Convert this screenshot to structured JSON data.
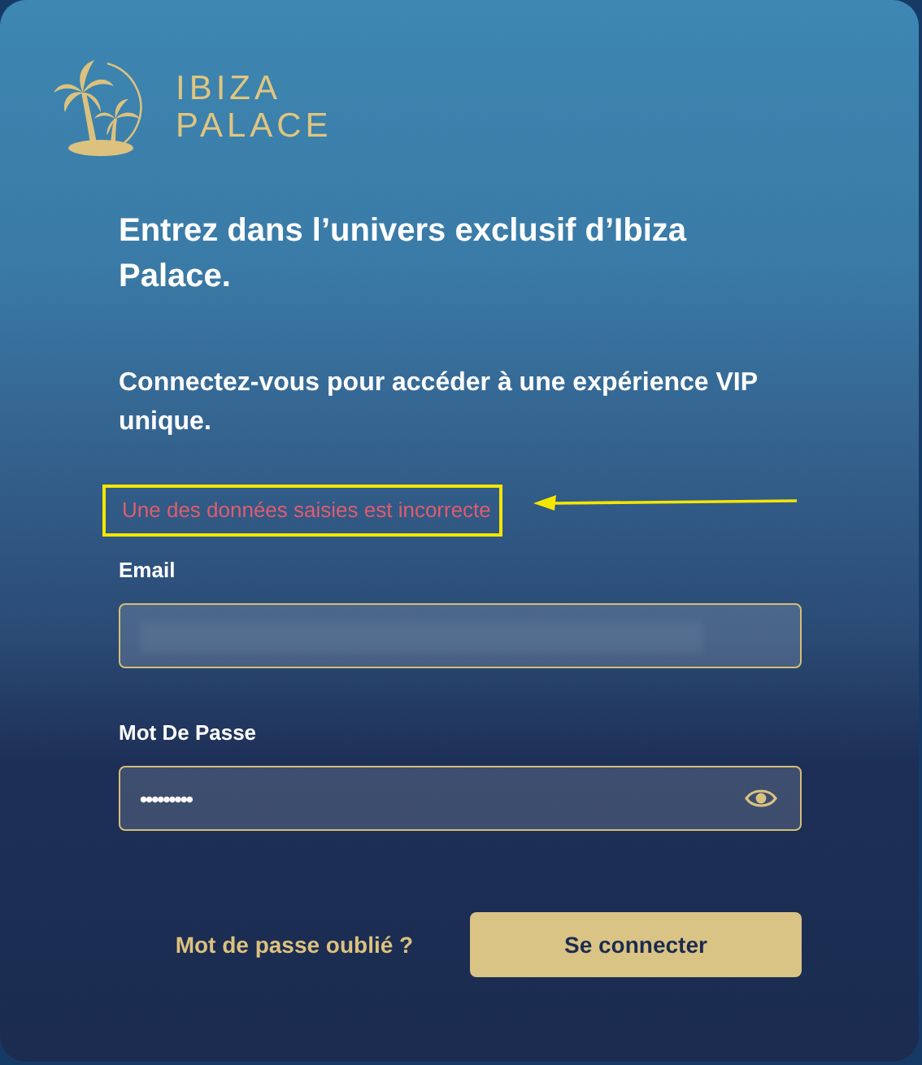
{
  "logo": {
    "lines": [
      "IBIZA",
      "PALACE"
    ]
  },
  "heading": "Entrez dans l’univers exclusif d’Ibiza Palace.",
  "subheading": "Connectez-vous pour accéder à une expérience VIP unique.",
  "error": {
    "text": "Une des données saisies est incorrecte",
    "highlighted": true
  },
  "fields": [
    {
      "label": "Email",
      "kind": "email"
    },
    {
      "label": "Mot De Passe",
      "value": "•••••••••",
      "kind": "password"
    }
  ],
  "forgot_link": "Mot de passe oublié ?",
  "submit_button": "Se connecter"
}
